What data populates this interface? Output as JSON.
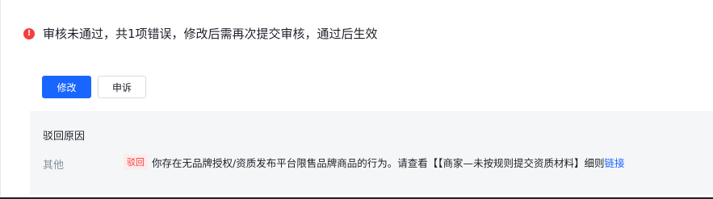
{
  "alert": {
    "icon": "error-icon",
    "icon_glyph": "!",
    "message": "审核未通过，共1项错误，修改后需再次提交审核，通过后生效"
  },
  "actions": {
    "modify_label": "修改",
    "appeal_label": "申诉"
  },
  "rejection": {
    "title": "驳回原因",
    "items": [
      {
        "category": "其他",
        "tag": "驳回",
        "text": "你存在无品牌授权/资质发布平台限售品牌商品的行为。请查看【【商家—未按规则提交资质材料】细则",
        "link_text": "链接"
      }
    ]
  },
  "colors": {
    "primary": "#1966ff",
    "error": "#f53f3f",
    "tag_bg": "#fdecec",
    "box_bg": "#f5f6f7"
  }
}
